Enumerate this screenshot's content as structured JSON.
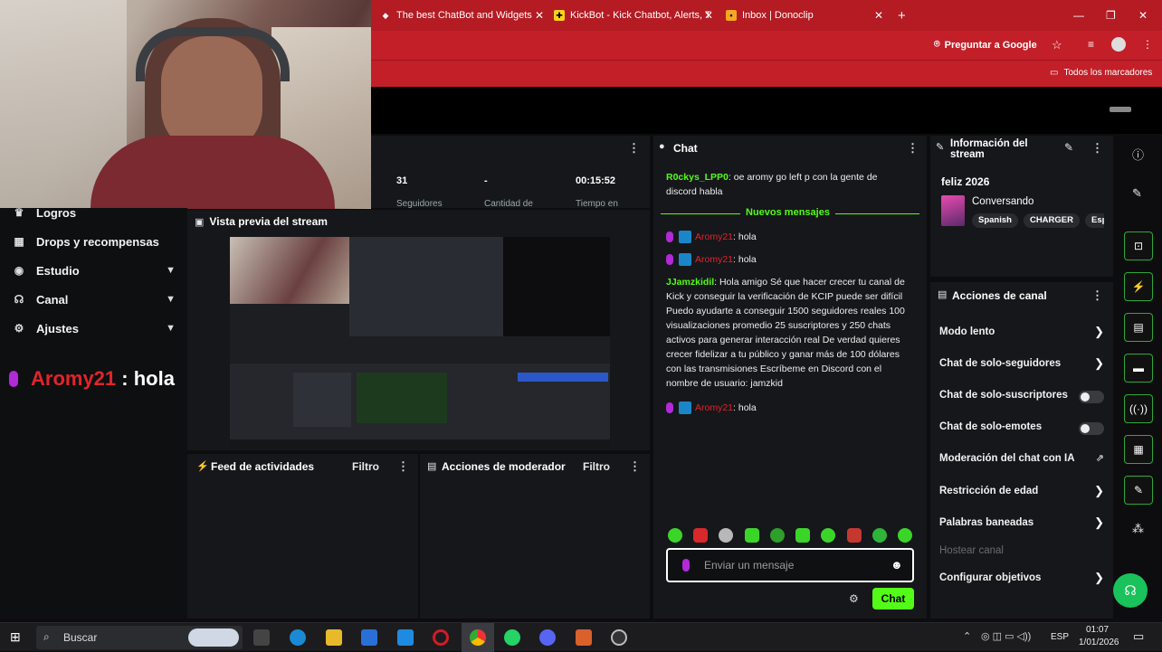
{
  "browser": {
    "tabs": [
      {
        "label": "The best ChatBot and Widgets"
      },
      {
        "label": "KickBot - Kick Chatbot, Alerts, T"
      },
      {
        "label": "Inbox | Donoclip"
      }
    ],
    "new_tab": "+",
    "ask_google": "Preguntar a Google",
    "bookmarks_label": "Todos los marcadores"
  },
  "stats": {
    "values": [
      "31",
      "-",
      "00:15:52"
    ],
    "labels": [
      "Seguidores",
      "Cantidad de",
      "Tiempo en"
    ]
  },
  "left_nav": {
    "items": [
      {
        "label": "Logros",
        "icon": "trophy-icon",
        "chevron": false
      },
      {
        "label": "Drops y recompensas",
        "icon": "gift-icon",
        "chevron": false
      },
      {
        "label": "Estudio",
        "icon": "studio-icon",
        "chevron": true
      },
      {
        "label": "Canal",
        "icon": "channel-icon",
        "chevron": true
      },
      {
        "label": "Ajustes",
        "icon": "gear-icon",
        "chevron": true
      }
    ]
  },
  "overlay": {
    "username": "Aromy21",
    "separator": " : ",
    "text": "hola"
  },
  "preview": {
    "title": "Vista previa del stream"
  },
  "activity": {
    "title": "Feed de actividades",
    "filter": "Filtro"
  },
  "mod_actions": {
    "title": "Acciones de moderador",
    "filter": "Filtro"
  },
  "chat": {
    "title": "Chat",
    "new_messages": "Nuevos mensajes",
    "messages": [
      {
        "user": "R0ckys_LPP0",
        "text": ": oe aromy go left p con la gente de discord habla"
      },
      {
        "user": "Aromy21",
        "text": ": hola"
      },
      {
        "user": "Aromy21",
        "text": ": hola"
      },
      {
        "user": "JJamzkidil",
        "text": ": Hola amigo Sé que hacer crecer tu canal de Kick y conseguir la verificación de KCIP puede ser difícil Puedo ayudarte a conseguir 1500 seguidores reales 100 visualizaciones promedio 25 suscriptores y 250 chats activos para generar interacción real De verdad quieres crecer fidelizar a tu público y ganar más de 100 dólares con las transmisiones Escríbeme en Discord con el nombre de usuario: jamzkid"
      },
      {
        "user": "Aromy21",
        "text": ": hola"
      }
    ],
    "input_placeholder": "Enviar un mensaje",
    "send_button": "Chat"
  },
  "stream_info": {
    "title": "Información del stream",
    "stream_title": "feliz 2026",
    "category": "Conversando",
    "tags": [
      "Spanish",
      "CHARGER",
      "Esp"
    ]
  },
  "channel_actions": {
    "title": "Acciones de canal",
    "items": [
      {
        "label": "Modo lento",
        "control": "chevron"
      },
      {
        "label": "Chat de solo-seguidores",
        "control": "chevron"
      },
      {
        "label": "Chat de solo-suscriptores",
        "control": "toggle"
      },
      {
        "label": "Chat de solo-emotes",
        "control": "toggle"
      },
      {
        "label": "Moderación del chat con IA",
        "control": "external"
      },
      {
        "label": "Restricción de edad",
        "control": "chevron"
      },
      {
        "label": "Palabras baneadas",
        "control": "chevron"
      },
      {
        "label": "Hostear canal",
        "control": "none",
        "disabled": true
      },
      {
        "label": "Configurar objetivos",
        "control": "chevron"
      }
    ]
  },
  "taskbar": {
    "search_placeholder": "Buscar",
    "time": "01:07",
    "date": "1/01/2026",
    "language": "ESP"
  },
  "colors": {
    "kick_green": "#53fc18",
    "browser_red": "#c21f28"
  }
}
